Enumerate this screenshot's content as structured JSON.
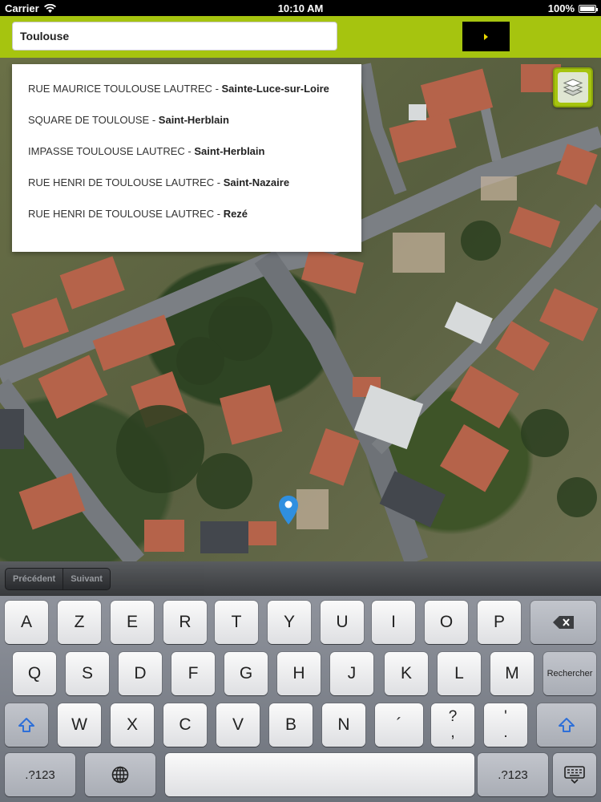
{
  "status_bar": {
    "carrier": "Carrier",
    "time": "10:10 AM",
    "battery_text": "100%",
    "battery_level": 1.0
  },
  "search": {
    "value": "Toulouse",
    "go_icon": "play-arrow-icon"
  },
  "layers_button": {
    "icon": "layers-icon"
  },
  "suggestions": [
    {
      "street": "RUE MAURICE TOULOUSE LAUTREC",
      "separator": " - ",
      "city": "Sainte-Luce-sur-Loire"
    },
    {
      "street": "SQUARE DE TOULOUSE",
      "separator": " - ",
      "city": "Saint-Herblain"
    },
    {
      "street": "IMPASSE TOULOUSE LAUTREC",
      "separator": " - ",
      "city": "Saint-Herblain"
    },
    {
      "street": "RUE HENRI DE TOULOUSE LAUTREC",
      "separator": " - ",
      "city": "Saint-Nazaire"
    },
    {
      "street": "RUE HENRI DE TOULOUSE LAUTREC",
      "separator": " - ",
      "city": "Rezé"
    }
  ],
  "map": {
    "marker_icon": "map-pin-icon",
    "marker_color": "#2f8fe0"
  },
  "accessory_bar": {
    "previous": "Précédent",
    "next": "Suivant"
  },
  "keyboard": {
    "row1": [
      "A",
      "Z",
      "E",
      "R",
      "T",
      "Y",
      "U",
      "I",
      "O",
      "P"
    ],
    "backspace_icon": "backspace-icon",
    "row2": [
      "Q",
      "S",
      "D",
      "F",
      "G",
      "H",
      "J",
      "K",
      "L",
      "M"
    ],
    "search_key": "Rechercher",
    "shift_icon": "shift-icon",
    "row3": [
      "W",
      "X",
      "C",
      "V",
      "B",
      "N"
    ],
    "accent_key": "´",
    "punct_key_1": {
      "top": "?",
      "bottom": ","
    },
    "punct_key_2": {
      "top": "'",
      "bottom": "."
    },
    "numbers_key": ".?123",
    "globe_icon": "globe-icon",
    "hide_keyboard_icon": "keyboard-hide-icon"
  },
  "colors": {
    "brand_green": "#a6c40f",
    "go_button": "#000000"
  }
}
